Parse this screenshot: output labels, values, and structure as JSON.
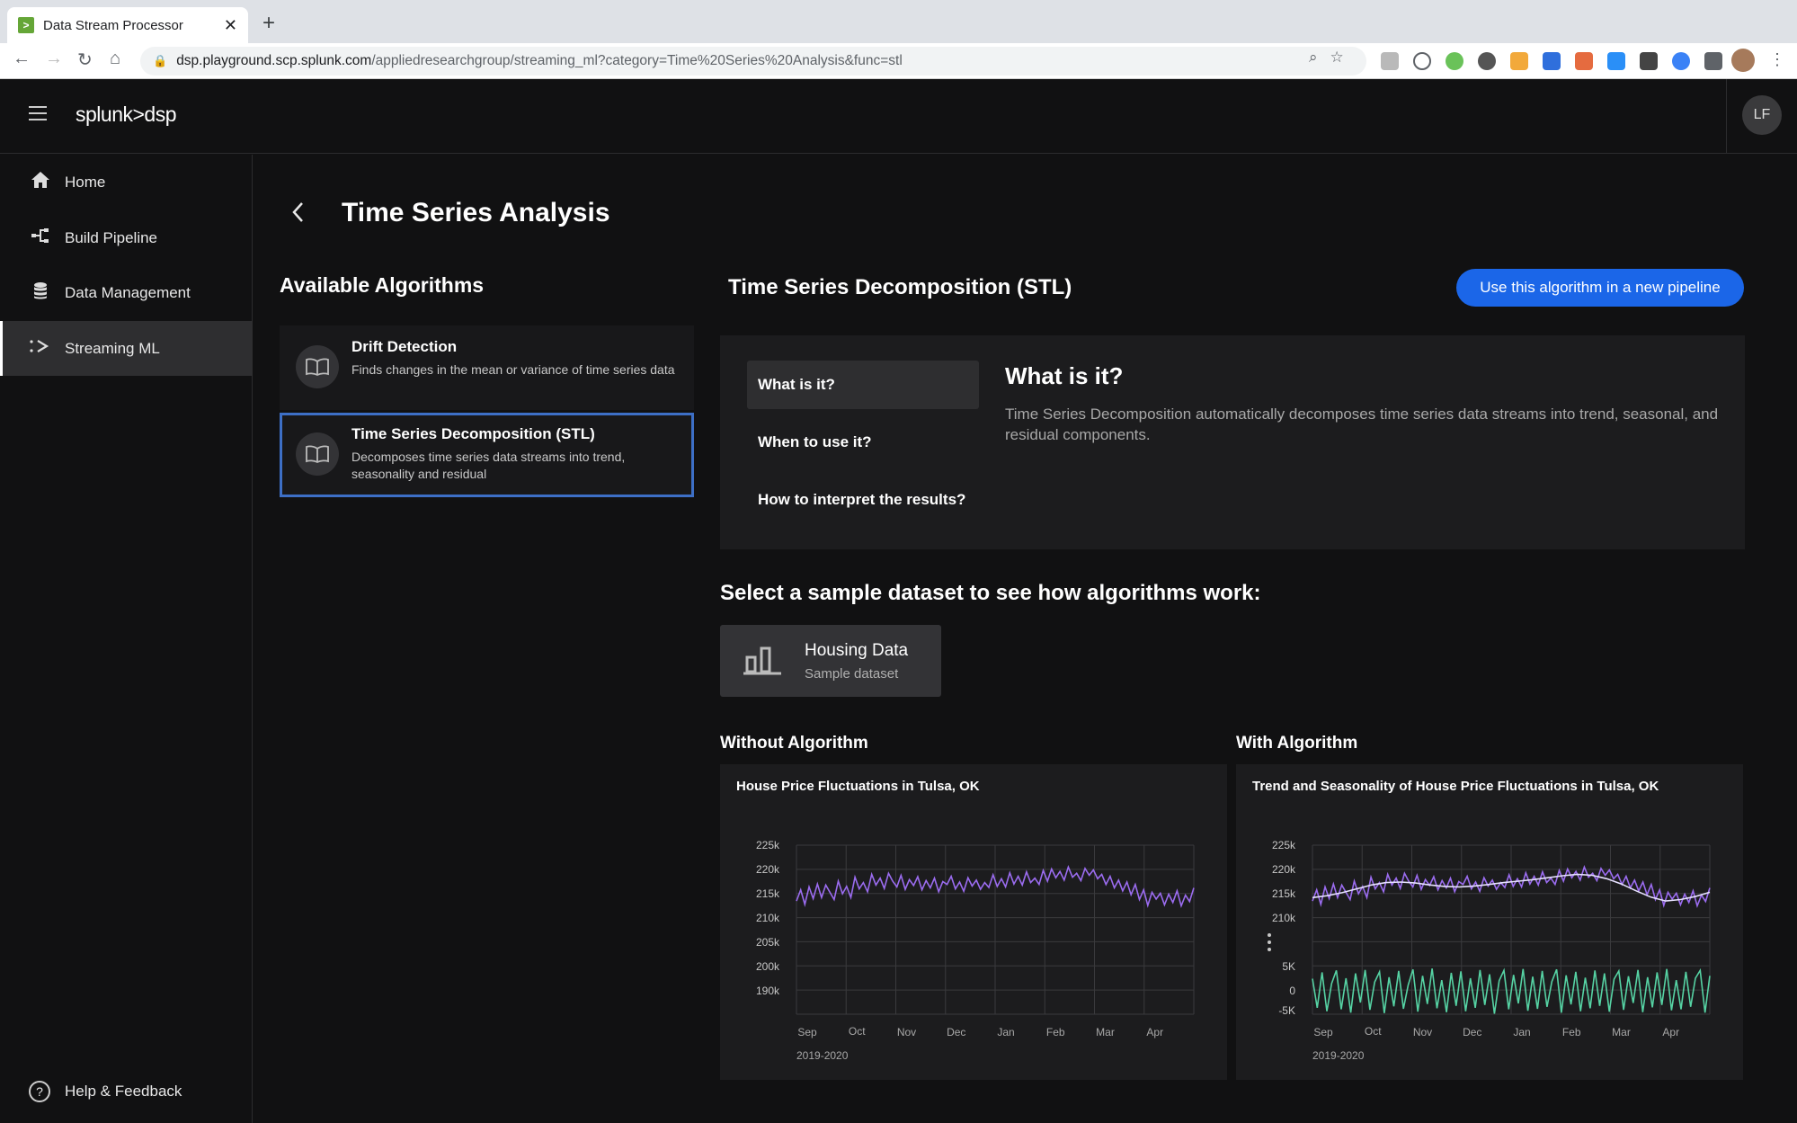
{
  "browser": {
    "tab_title": "Data Stream Processor",
    "url_host": "dsp.playground.scp.splunk.com",
    "url_path": "/appliedresearchgroup/streaming_ml?category=Time%20Series%20Analysis&func=stl"
  },
  "header": {
    "logo": "splunk>dsp",
    "avatar": "LF"
  },
  "sidebar": {
    "items": [
      {
        "label": "Home",
        "icon": "home-icon"
      },
      {
        "label": "Build Pipeline",
        "icon": "pipeline-icon"
      },
      {
        "label": "Data Management",
        "icon": "database-icon"
      },
      {
        "label": "Streaming ML",
        "icon": "streaming-icon"
      }
    ],
    "help": "Help & Feedback"
  },
  "page": {
    "title": "Time Series Analysis"
  },
  "algorithms": {
    "heading": "Available Algorithms",
    "items": [
      {
        "name": "Drift Detection",
        "desc": "Finds changes in the mean or variance of time series data"
      },
      {
        "name": "Time Series Decomposition (STL)",
        "desc": "Decomposes time series data streams into trend, seasonality and residual"
      }
    ]
  },
  "detail": {
    "title": "Time Series Decomposition (STL)",
    "cta": "Use this algorithm in a new pipeline",
    "tabs": [
      "What is it?",
      "When to use it?",
      "How to interpret the results?"
    ],
    "heading": "What is it?",
    "body": "Time Series Decomposition automatically decomposes time series data streams into trend, seasonal, and residual components."
  },
  "dataset": {
    "heading": "Select a sample dataset to see how algorithms work:",
    "name": "Housing Data",
    "sub": "Sample dataset"
  },
  "charts": {
    "without_label": "Without Algorithm",
    "with_label": "With Algorithm"
  },
  "colors": {
    "accent": "#1b66e8",
    "series_raw": "#9b6cf0",
    "series_trend": "#e6e0ff",
    "series_residual": "#56d3a4",
    "selected_border": "#3d6fc6"
  },
  "chart_data": [
    {
      "type": "line",
      "title": "House Price Fluctuations in Tulsa, OK",
      "xlabel": "2019-2020",
      "ylabel": "",
      "x_ticks": [
        "Sep",
        "Oct",
        "Nov",
        "Dec",
        "Jan",
        "Feb",
        "Mar",
        "Apr"
      ],
      "y_ticks": [
        "225k",
        "220k",
        "215k",
        "210k",
        "205k",
        "200k",
        "190k"
      ],
      "ylim": [
        185000,
        227500
      ],
      "grid": true,
      "series": [
        {
          "values": [
            213500,
            215800,
            212800,
            216400,
            214000,
            217000,
            214200,
            216800,
            215300,
            213800,
            217600,
            215000,
            216500,
            214200,
            218400,
            216000,
            217300,
            215400,
            219000,
            216800,
            218200,
            216100,
            219200,
            217600,
            216400,
            218800,
            215900,
            217900,
            216700,
            218500,
            215800,
            217700,
            216200,
            218200,
            215400,
            217500,
            216900,
            218600,
            216000,
            217400,
            215500,
            218300,
            216600,
            217800,
            215900,
            217300,
            216300,
            218900,
            216500,
            218100,
            216400,
            219300,
            217000,
            218600,
            216800,
            219500,
            217300,
            218200,
            216900,
            219800,
            217600,
            220100,
            218300,
            219600,
            217800,
            220500,
            218400,
            219200,
            217700,
            220200,
            218800,
            219900,
            218100,
            219000,
            216900,
            218600,
            216200,
            217800,
            215600,
            217400,
            214800,
            216900,
            213800,
            215800,
            212600,
            215300,
            213900,
            215100,
            212700,
            214900,
            213200,
            215600,
            212500,
            214700,
            213400,
            216200
          ]
        }
      ]
    },
    {
      "type": "line",
      "title": "Trend and Seasonality of House Price Fluctuations in Tulsa, OK",
      "xlabel": "2019-2020",
      "ylabel": "",
      "x_ticks": [
        "Sep",
        "Oct",
        "Nov",
        "Dec",
        "Jan",
        "Feb",
        "Mar",
        "Apr"
      ],
      "y_ticks_upper": [
        "225k",
        "220k",
        "215k",
        "210k"
      ],
      "y_ticks_lower": [
        "5K",
        "0",
        "-5K"
      ],
      "grid": true,
      "series": [
        {
          "values": [
            213500,
            215800,
            212800,
            216400,
            214000,
            217000,
            214200,
            216800,
            215300,
            213800,
            217600,
            215000,
            216500,
            214200,
            218400,
            216000,
            217300,
            215400,
            219000,
            216800,
            218200,
            216100,
            219200,
            217600,
            216400,
            218800,
            215900,
            217900,
            216700,
            218500,
            215800,
            217700,
            216200,
            218200,
            215400,
            217500,
            216900,
            218600,
            216000,
            217400,
            215500,
            218300,
            216600,
            217800,
            215900,
            217300,
            216300,
            218900,
            216500,
            218100,
            216400,
            219300,
            217000,
            218600,
            216800,
            219500,
            217300,
            218200,
            216900,
            219800,
            217600,
            220100,
            218300,
            219600,
            217800,
            220500,
            218400,
            219200,
            217700,
            220200,
            218800,
            219900,
            218100,
            219000,
            216900,
            218600,
            216200,
            217800,
            215600,
            217400,
            214800,
            216900,
            213800,
            215800,
            212600,
            215300,
            213900,
            215100,
            212700,
            214900,
            213200,
            215600,
            212500,
            214700,
            213400,
            216200
          ]
        },
        {
          "values": [
            214200,
            214600,
            215200,
            216000,
            216800,
            217300,
            217400,
            217200,
            216800,
            216500,
            216400,
            216600,
            216900,
            217300,
            217600,
            217900,
            218300,
            218700,
            219000,
            218800,
            218100,
            217000,
            215600,
            214300,
            213500,
            213800,
            214400,
            215300
          ]
        },
        {
          "values": [
            2500,
            -3500,
            3800,
            -4200,
            1500,
            4200,
            -3800,
            2600,
            -4500,
            3600,
            -2400,
            4300,
            -3900,
            1800,
            3900,
            -4600,
            2800,
            -3200,
            4100,
            -3700,
            1200,
            4400,
            -4300,
            3100,
            -2700,
            4600,
            -3600,
            2200,
            -4400,
            3700,
            -3100,
            4000,
            -4200,
            2600,
            -3500,
            4300,
            -2900,
            3400,
            -4700,
            2100,
            4200,
            -3800,
            3300,
            -2600,
            4500,
            -4100,
            2900,
            -3700,
            4100,
            -3300,
            1900,
            4400,
            -4500,
            3200,
            -2800,
            3900,
            -4200,
            2700,
            -3600,
            4200,
            -3100,
            3600,
            -4300,
            2400,
            4100,
            -3900,
            3000,
            -2500,
            4300,
            -4400,
            2800,
            -3400,
            3800,
            -2900,
            4500,
            -4000,
            2200,
            -3800,
            3900,
            -3300,
            2600,
            4200,
            -4500,
            3100
          ]
        }
      ]
    }
  ]
}
